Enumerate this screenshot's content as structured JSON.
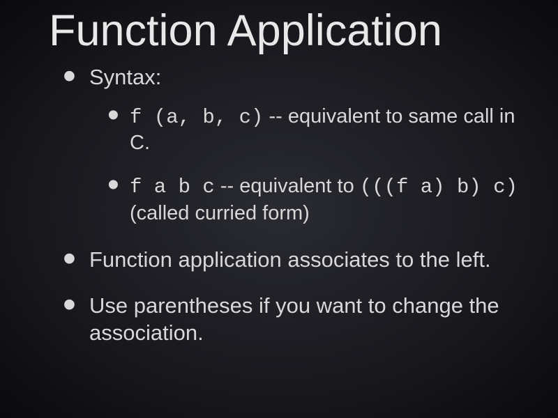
{
  "title": "Function Application",
  "bullets": {
    "b1": {
      "text": "Syntax:",
      "sub": {
        "s1": {
          "code1": "f (a, b, c)",
          "text1": " -- equivalent to same call in C."
        },
        "s2": {
          "code1": "f a b c",
          "text1": " -- equivalent to ",
          "code2": "(((f a) b) c)",
          "text2": " (called curried form)"
        }
      }
    },
    "b2": {
      "text": "Function application associates to the left."
    },
    "b3": {
      "text": "Use parentheses if you want to change the association."
    }
  }
}
